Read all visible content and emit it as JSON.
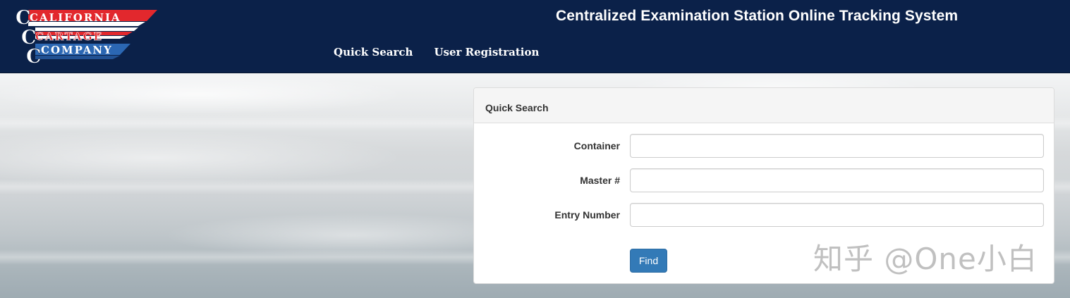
{
  "header": {
    "logo": {
      "line1": "CALIFORNIA",
      "line2": "CARTAGE",
      "line3": "COMPANY",
      "colors": {
        "red": "#e2282d",
        "blue": "#2b67b3",
        "white": "#ffffff"
      }
    },
    "site_title": "Centralized Examination Station Online Tracking System",
    "nav": [
      {
        "label": "Quick Search"
      },
      {
        "label": "User Registration"
      }
    ],
    "background_color": "#0b2149"
  },
  "quick_search": {
    "heading": "Quick Search",
    "fields": [
      {
        "label": "Container",
        "value": "",
        "placeholder": ""
      },
      {
        "label": "Master #",
        "value": "",
        "placeholder": ""
      },
      {
        "label": "Entry Number",
        "value": "",
        "placeholder": ""
      }
    ],
    "find_label": "Find",
    "button_color": "#337ab7"
  },
  "watermark": "知乎 @One小白"
}
